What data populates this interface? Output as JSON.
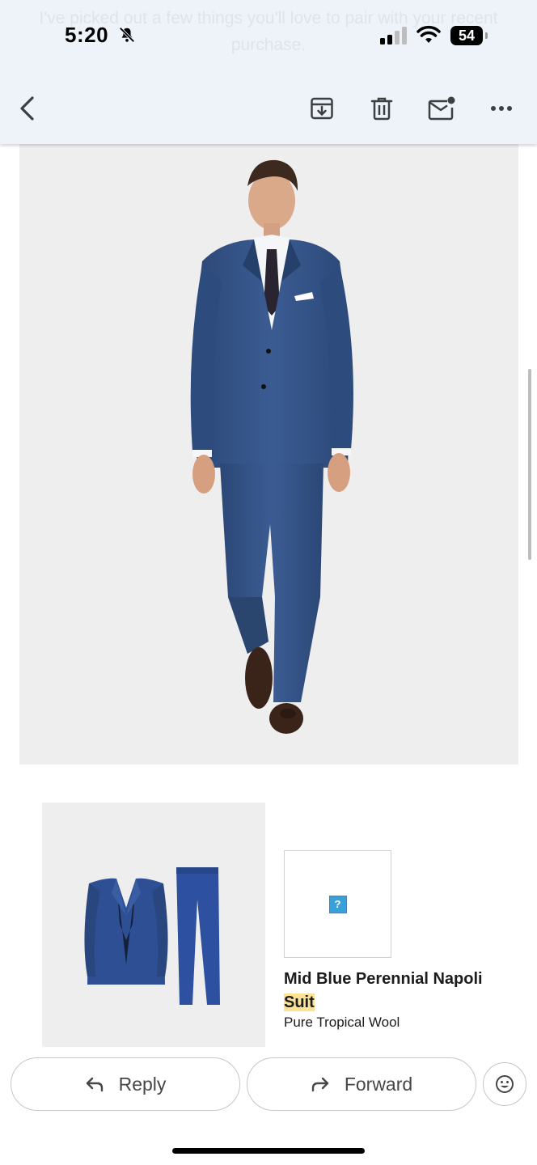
{
  "status_bar": {
    "time": "5:20",
    "battery": "54"
  },
  "email": {
    "preheader_text": "I've picked out a few things you'll love to pair with your recent purchase."
  },
  "product": {
    "name_part1": "Mid Blue Perennial Napoli",
    "name_highlight": "Suit",
    "subtitle": "Pure Tropical Wool",
    "broken_image_glyph": "?"
  },
  "actions": {
    "reply_label": "Reply",
    "forward_label": "Forward"
  },
  "icons": {
    "back": "back-arrow-icon",
    "archive": "archive-icon",
    "delete": "trash-icon",
    "mark_unread": "mark-unread-icon",
    "more": "more-options-icon",
    "emoji": "emoji-reaction-icon"
  },
  "colors": {
    "header_bg": "#eef2f9",
    "image_bg": "#efeeee",
    "suit_blue": "#2f4f86",
    "highlight": "#fde293"
  }
}
